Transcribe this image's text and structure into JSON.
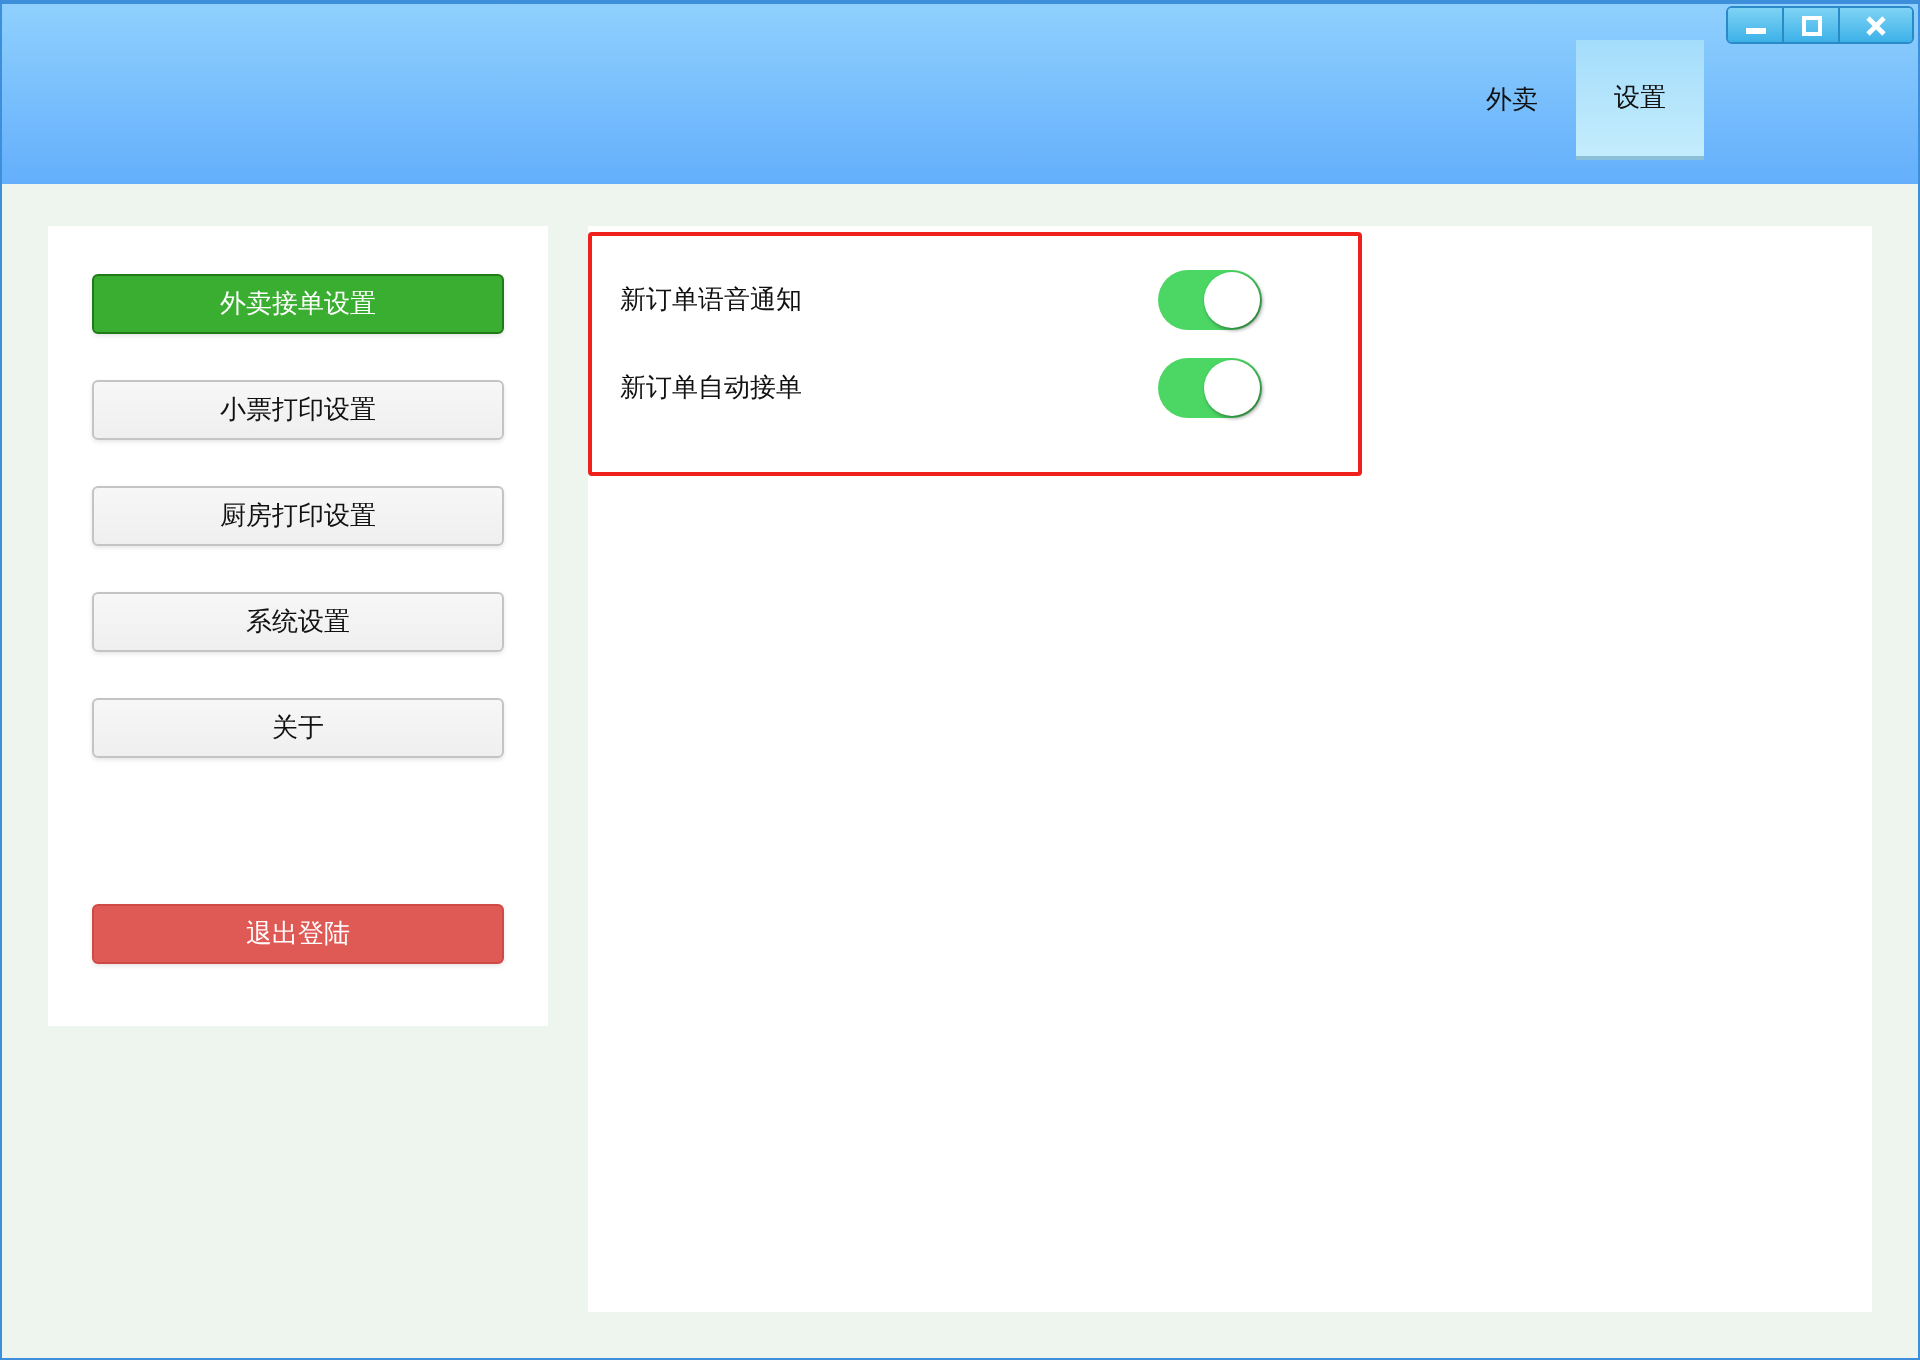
{
  "nav_tabs": [
    {
      "label": "外卖",
      "selected": false
    },
    {
      "label": "设置",
      "selected": true
    }
  ],
  "sidebar": {
    "items": [
      {
        "label": "外卖接单设置",
        "selected": true
      },
      {
        "label": "小票打印设置",
        "selected": false
      },
      {
        "label": "厨房打印设置",
        "selected": false
      },
      {
        "label": "系统设置",
        "selected": false
      },
      {
        "label": "关于",
        "selected": false
      }
    ],
    "logout_button": "退出登陆"
  },
  "settings": [
    {
      "label": "新订单语音通知",
      "on": true
    },
    {
      "label": "新订单自动接单",
      "on": true
    }
  ]
}
